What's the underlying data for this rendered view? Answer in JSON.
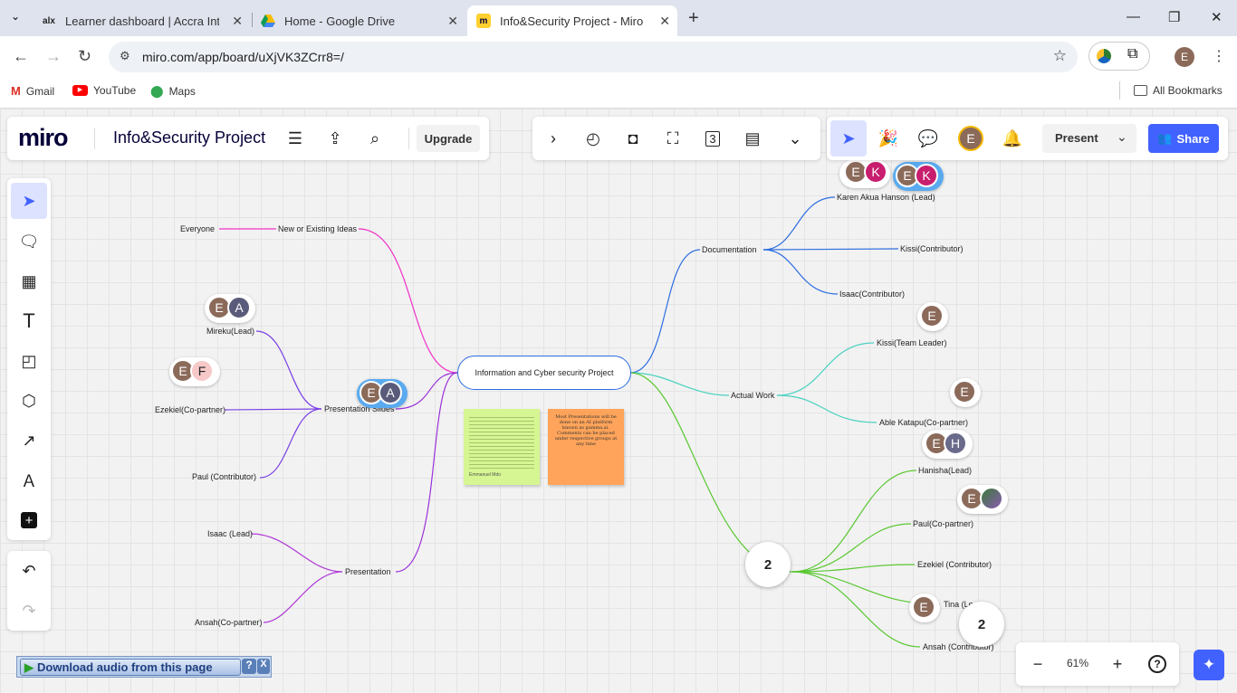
{
  "browser": {
    "tabs": [
      {
        "favicon": "alx",
        "title": "Learner dashboard | Accra Intra"
      },
      {
        "favicon": "drive",
        "title": "Home - Google Drive"
      },
      {
        "favicon": "miro",
        "title": "Info&Security Project - Miro"
      }
    ],
    "url": "miro.com/app/board/uXjVK3ZCrr8=/",
    "bookmarks": [
      "Gmail",
      "YouTube",
      "Maps"
    ],
    "all_bookmarks": "All Bookmarks",
    "profile_initial": "E"
  },
  "miro": {
    "logo": "miro",
    "board_title": "Info&Security Project",
    "upgrade": "Upgrade",
    "present": "Present",
    "share": "Share",
    "timer_badge": "3",
    "zoom": "61%",
    "user_initial": "E"
  },
  "mindmap": {
    "center": "Information and Cyber security Project",
    "branches": {
      "ideas": "New or Existing Ideas",
      "everyone": "Everyone",
      "slides": "Presentation Slides",
      "mireku": "Mireku(Lead)",
      "ezekiel_cp": "Ezekiel(Co-partner)",
      "paul_contrib": "Paul (Contributor)",
      "presentation": "Presentation",
      "isaac_lead": "Isaac (Lead)",
      "ansah_cp": "Ansah(Co-partner)",
      "documentation": "Documentation",
      "karen": "Karen Akua Hanson (Lead)",
      "kissi_contrib": "Kissi(Contributor)",
      "isaac_contrib": "Isaac(Contributor)",
      "actual": "Actual Work",
      "kissi_tl": "Kissi(Team Leader)",
      "able": "Able Katapu(Co-partner)",
      "hanisha": "Hanisha(Lead)",
      "paul_cp": "Paul(Co-partner)",
      "ezekiel_contrib": "Ezekiel (Contributor)",
      "tina": "Tina (Le...",
      "ansah_contrib": "Ansah (Contributor)"
    },
    "comment_counts": [
      "2",
      "2"
    ]
  },
  "avatars": {
    "e": "E",
    "k": "K",
    "a": "A",
    "f": "F",
    "h": "H"
  },
  "stickies": {
    "green_sign": "Emmanuel Mdo",
    "orange_text": "Most Presentations will be done on an AI platform known as gamma.ai. Comments can be placed under respective groups at any time"
  },
  "extension": {
    "download_audio": "Download audio from this page",
    "help": "?",
    "close": "X"
  },
  "colors": {
    "accent": "#4262ff",
    "tabbar": "#dfe3ee",
    "pink": "#f032c8",
    "purple": "#8a2be2",
    "blue": "#2d6de0",
    "teal": "#48d1c0",
    "green": "#5ac832"
  }
}
